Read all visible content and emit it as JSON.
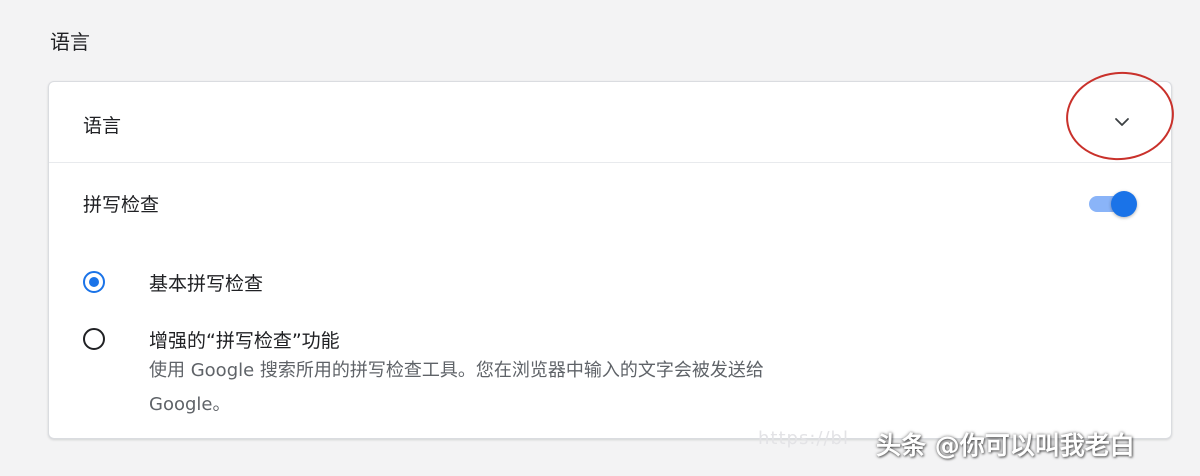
{
  "section": {
    "title": "语言"
  },
  "language_row": {
    "label": "语言",
    "icon": "chevron-down-icon",
    "highlight_color": "#c9312b"
  },
  "spell_check": {
    "label": "拼写检查",
    "enabled": true,
    "accent": "#1a73e8"
  },
  "options": [
    {
      "label": "基本拼写检查",
      "selected": true
    },
    {
      "label": "增强的“拼写检查”功能",
      "selected": false,
      "description_line1": "使用 Google 搜索所用的拼写检查工具。您在浏览器中输入的文字会被发送给",
      "description_line2": "Google。"
    }
  ],
  "watermark": {
    "url_fragment": "https://bl",
    "text": "头条 @你可以叫我老白"
  }
}
